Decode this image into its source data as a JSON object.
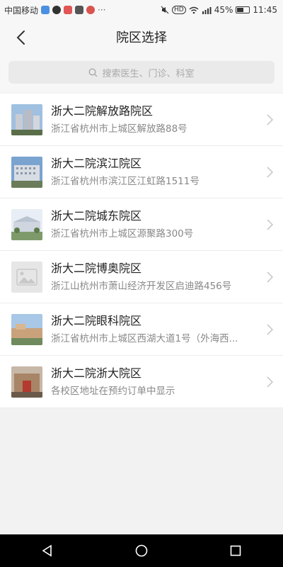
{
  "status": {
    "carrier": "中国移动",
    "battery": "45%",
    "time": "11:45"
  },
  "header": {
    "title": "院区选择"
  },
  "search": {
    "placeholder": "搜索医生、门诊、科室"
  },
  "campuses": [
    {
      "name": "浙大二院解放路院区",
      "address": "浙江省杭州市上城区解放路88号",
      "thumbnail": "building-photo"
    },
    {
      "name": "浙大二院滨江院区",
      "address": "浙江省杭州市滨江区江虹路1511号",
      "thumbnail": "building-photo"
    },
    {
      "name": "浙大二院城东院区",
      "address": "浙江省杭州市上城区源聚路300号",
      "thumbnail": "building-photo"
    },
    {
      "name": "浙大二院博奥院区",
      "address": "浙江山杭州市萧山经济开发区启迪路456号",
      "thumbnail": "image-placeholder"
    },
    {
      "name": "浙大二院眼科院区",
      "address": "浙江省杭州市上城区西湖大道1号（外海西...",
      "thumbnail": "building-photo"
    },
    {
      "name": "浙大二院浙大院区",
      "address": "各校区地址在预约订单中显示",
      "thumbnail": "building-photo"
    }
  ],
  "colors": {
    "background": "#f2f2f2",
    "header_bg": "#f7f7f7",
    "primary_text": "#222222",
    "secondary_text": "#888888"
  }
}
